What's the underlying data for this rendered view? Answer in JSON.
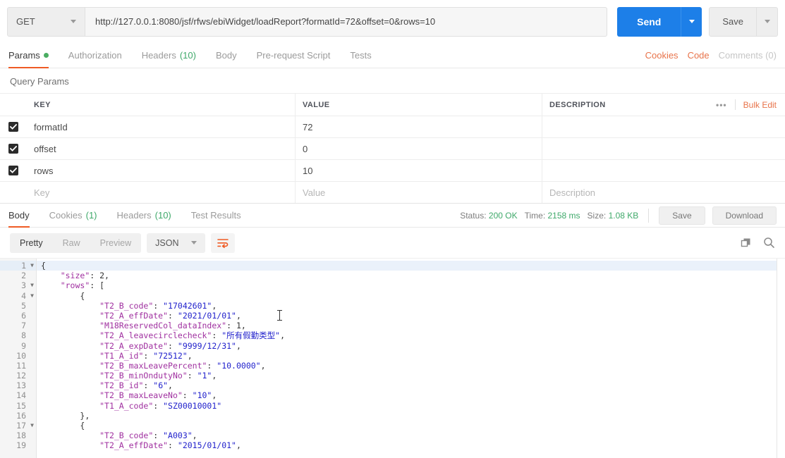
{
  "request": {
    "method": "GET",
    "url": "http://127.0.0.1:8080/jsf/rfws/ebiWidget/loadReport?formatId=72&offset=0&rows=10",
    "send_label": "Send",
    "save_label": "Save"
  },
  "request_tabs": [
    {
      "label": "Params",
      "badge": "",
      "dot": true,
      "active": true
    },
    {
      "label": "Authorization",
      "badge": "",
      "dot": false,
      "active": false
    },
    {
      "label": "Headers",
      "badge": "(10)",
      "dot": false,
      "active": false
    },
    {
      "label": "Body",
      "badge": "",
      "dot": false,
      "active": false
    },
    {
      "label": "Pre-request Script",
      "badge": "",
      "dot": false,
      "active": false
    },
    {
      "label": "Tests",
      "badge": "",
      "dot": false,
      "active": false
    }
  ],
  "request_tabs_right": {
    "cookies": "Cookies",
    "code": "Code",
    "comments": "Comments (0)"
  },
  "query_params": {
    "title": "Query Params",
    "columns": {
      "key": "KEY",
      "value": "VALUE",
      "description": "DESCRIPTION"
    },
    "bulk_edit": "Bulk Edit",
    "dots": "•••",
    "rows": [
      {
        "checked": true,
        "key": "formatId",
        "value": "72",
        "description": ""
      },
      {
        "checked": true,
        "key": "offset",
        "value": "0",
        "description": ""
      },
      {
        "checked": true,
        "key": "rows",
        "value": "10",
        "description": ""
      }
    ],
    "placeholder_row": {
      "key": "Key",
      "value": "Value",
      "description": "Description"
    }
  },
  "response_tabs": [
    {
      "label": "Body",
      "badge": "",
      "active": true
    },
    {
      "label": "Cookies",
      "badge": "(1)",
      "active": false
    },
    {
      "label": "Headers",
      "badge": "(10)",
      "active": false
    },
    {
      "label": "Test Results",
      "badge": "",
      "active": false
    }
  ],
  "response_meta": {
    "status_label": "Status:",
    "status_value": "200 OK",
    "time_label": "Time:",
    "time_value": "2158 ms",
    "size_label": "Size:",
    "size_value": "1.08 KB",
    "save_label": "Save",
    "download_label": "Download"
  },
  "body_toolbar": {
    "views": [
      {
        "label": "Pretty",
        "active": true
      },
      {
        "label": "Raw",
        "active": false
      },
      {
        "label": "Preview",
        "active": false
      }
    ],
    "format": "JSON"
  },
  "colors": {
    "accent_orange": "#ef5b25",
    "link_orange": "#e8734a",
    "send_blue": "#1d7fe8",
    "status_green": "#3fa96a",
    "json_key": "#a030a0",
    "json_string": "#2222cc"
  },
  "response_body": {
    "lines": [
      {
        "n": 1,
        "fold": true,
        "active": true,
        "indent": 0,
        "tokens": [
          {
            "t": "p",
            "v": "{"
          }
        ]
      },
      {
        "n": 2,
        "fold": false,
        "active": false,
        "indent": 1,
        "tokens": [
          {
            "t": "k",
            "v": "\"size\""
          },
          {
            "t": "p",
            "v": ": "
          },
          {
            "t": "n",
            "v": "2,"
          }
        ]
      },
      {
        "n": 3,
        "fold": true,
        "active": false,
        "indent": 1,
        "tokens": [
          {
            "t": "k",
            "v": "\"rows\""
          },
          {
            "t": "p",
            "v": ": ["
          }
        ]
      },
      {
        "n": 4,
        "fold": true,
        "active": false,
        "indent": 2,
        "tokens": [
          {
            "t": "p",
            "v": "{"
          }
        ]
      },
      {
        "n": 5,
        "fold": false,
        "active": false,
        "indent": 3,
        "tokens": [
          {
            "t": "k",
            "v": "\"T2_B_code\""
          },
          {
            "t": "p",
            "v": ": "
          },
          {
            "t": "s",
            "v": "\"17042601\""
          },
          {
            "t": "p",
            "v": ","
          }
        ]
      },
      {
        "n": 6,
        "fold": false,
        "active": false,
        "indent": 3,
        "tokens": [
          {
            "t": "k",
            "v": "\"T2_A_effDate\""
          },
          {
            "t": "p",
            "v": ": "
          },
          {
            "t": "s",
            "v": "\"2021/01/01\""
          },
          {
            "t": "p",
            "v": ","
          }
        ]
      },
      {
        "n": 7,
        "fold": false,
        "active": false,
        "indent": 3,
        "tokens": [
          {
            "t": "k",
            "v": "\"M18ReservedCol_dataIndex\""
          },
          {
            "t": "p",
            "v": ": "
          },
          {
            "t": "n",
            "v": "1,"
          }
        ]
      },
      {
        "n": 8,
        "fold": false,
        "active": false,
        "indent": 3,
        "tokens": [
          {
            "t": "k",
            "v": "\"T2_A_leavecirclecheck\""
          },
          {
            "t": "p",
            "v": ": "
          },
          {
            "t": "s",
            "v": "\"所有假勤类型\""
          },
          {
            "t": "p",
            "v": ","
          }
        ]
      },
      {
        "n": 9,
        "fold": false,
        "active": false,
        "indent": 3,
        "tokens": [
          {
            "t": "k",
            "v": "\"T2_A_expDate\""
          },
          {
            "t": "p",
            "v": ": "
          },
          {
            "t": "s",
            "v": "\"9999/12/31\""
          },
          {
            "t": "p",
            "v": ","
          }
        ]
      },
      {
        "n": 10,
        "fold": false,
        "active": false,
        "indent": 3,
        "tokens": [
          {
            "t": "k",
            "v": "\"T1_A_id\""
          },
          {
            "t": "p",
            "v": ": "
          },
          {
            "t": "s",
            "v": "\"72512\""
          },
          {
            "t": "p",
            "v": ","
          }
        ]
      },
      {
        "n": 11,
        "fold": false,
        "active": false,
        "indent": 3,
        "tokens": [
          {
            "t": "k",
            "v": "\"T2_B_maxLeavePercent\""
          },
          {
            "t": "p",
            "v": ": "
          },
          {
            "t": "s",
            "v": "\"10.0000\""
          },
          {
            "t": "p",
            "v": ","
          }
        ]
      },
      {
        "n": 12,
        "fold": false,
        "active": false,
        "indent": 3,
        "tokens": [
          {
            "t": "k",
            "v": "\"T2_B_minOndutyNo\""
          },
          {
            "t": "p",
            "v": ": "
          },
          {
            "t": "s",
            "v": "\"1\""
          },
          {
            "t": "p",
            "v": ","
          }
        ]
      },
      {
        "n": 13,
        "fold": false,
        "active": false,
        "indent": 3,
        "tokens": [
          {
            "t": "k",
            "v": "\"T2_B_id\""
          },
          {
            "t": "p",
            "v": ": "
          },
          {
            "t": "s",
            "v": "\"6\""
          },
          {
            "t": "p",
            "v": ","
          }
        ]
      },
      {
        "n": 14,
        "fold": false,
        "active": false,
        "indent": 3,
        "tokens": [
          {
            "t": "k",
            "v": "\"T2_B_maxLeaveNo\""
          },
          {
            "t": "p",
            "v": ": "
          },
          {
            "t": "s",
            "v": "\"10\""
          },
          {
            "t": "p",
            "v": ","
          }
        ]
      },
      {
        "n": 15,
        "fold": false,
        "active": false,
        "indent": 3,
        "tokens": [
          {
            "t": "k",
            "v": "\"T1_A_code\""
          },
          {
            "t": "p",
            "v": ": "
          },
          {
            "t": "s",
            "v": "\"SZ00010001\""
          }
        ]
      },
      {
        "n": 16,
        "fold": false,
        "active": false,
        "indent": 2,
        "tokens": [
          {
            "t": "p",
            "v": "},"
          }
        ]
      },
      {
        "n": 17,
        "fold": true,
        "active": false,
        "indent": 2,
        "tokens": [
          {
            "t": "p",
            "v": "{"
          }
        ]
      },
      {
        "n": 18,
        "fold": false,
        "active": false,
        "indent": 3,
        "tokens": [
          {
            "t": "k",
            "v": "\"T2_B_code\""
          },
          {
            "t": "p",
            "v": ": "
          },
          {
            "t": "s",
            "v": "\"A003\""
          },
          {
            "t": "p",
            "v": ","
          }
        ]
      },
      {
        "n": 19,
        "fold": false,
        "active": false,
        "indent": 3,
        "tokens": [
          {
            "t": "k",
            "v": "\"T2_A_effDate\""
          },
          {
            "t": "p",
            "v": ": "
          },
          {
            "t": "s",
            "v": "\"2015/01/01\""
          },
          {
            "t": "p",
            "v": ","
          }
        ]
      }
    ]
  }
}
